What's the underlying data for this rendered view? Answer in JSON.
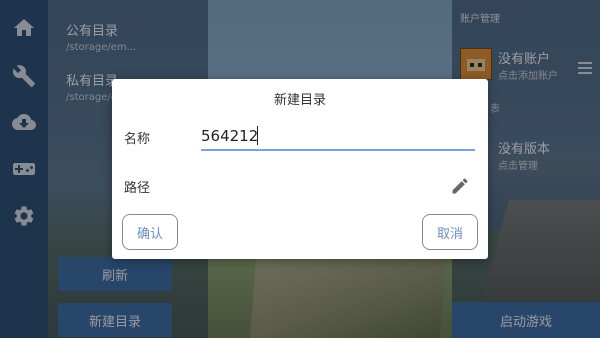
{
  "left_list": {
    "items": [
      {
        "title": "公有目录",
        "path": "/storage/em..."
      },
      {
        "title": "私有目录",
        "path": "/storage/e..."
      }
    ],
    "refresh_label": "刷新",
    "new_dir_label": "新建目录"
  },
  "rail": {
    "icons": [
      "home-icon",
      "wrench-icon",
      "cloud-download-icon",
      "gamepad-icon",
      "settings-icon"
    ]
  },
  "right_panel": {
    "header": "账户管理",
    "account_title": "没有账户",
    "account_sub": "点击添加账户",
    "section_label": "表",
    "version_title": "没有版本",
    "version_sub": "点击管理",
    "launch_label": "启动游戏"
  },
  "dialog": {
    "title": "新建目录",
    "name_label": "名称",
    "name_value": "564212",
    "path_label": "路径",
    "confirm_label": "确认",
    "cancel_label": "取消"
  },
  "colors": {
    "accent": "#3e6aa3",
    "underline": "#7aa1d8",
    "button_text": "#6c8fbf"
  }
}
